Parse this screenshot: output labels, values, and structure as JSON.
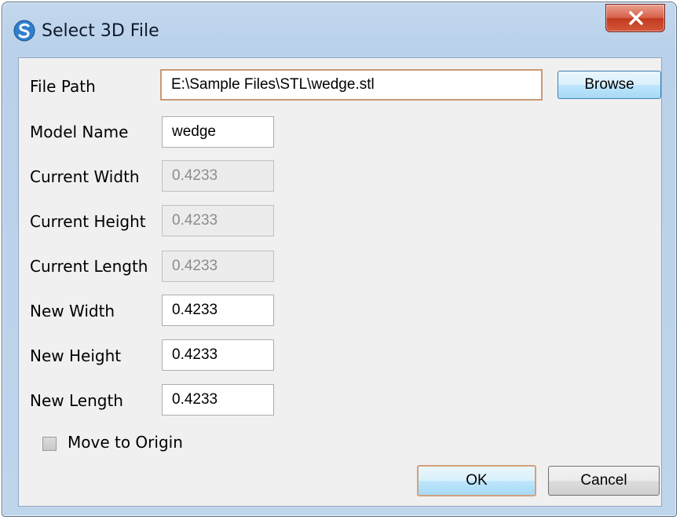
{
  "window": {
    "title": "Select 3D File"
  },
  "form": {
    "file_path": {
      "label": "File Path",
      "value": "E:\\Sample Files\\STL\\wedge.stl"
    },
    "browse_label": "Browse",
    "model_name": {
      "label": "Model Name",
      "value": "wedge"
    },
    "current_width": {
      "label": "Current Width",
      "value": "0.4233"
    },
    "current_height": {
      "label": "Current Height",
      "value": "0.4233"
    },
    "current_length": {
      "label": "Current Length",
      "value": "0.4233"
    },
    "new_width": {
      "label": "New Width",
      "value": "0.4233"
    },
    "new_height": {
      "label": "New Height",
      "value": "0.4233"
    },
    "new_length": {
      "label": "New Length",
      "value": "0.4233"
    },
    "move_to_origin": {
      "label": "Move to Origin",
      "checked": false,
      "enabled": false
    }
  },
  "buttons": {
    "ok": "OK",
    "cancel": "Cancel"
  },
  "icons": {
    "app": "app-logo-icon",
    "close": "close-icon"
  },
  "colors": {
    "title_bar": "#b9d1ea",
    "client_background": "#f0f0f0",
    "close_button": "#c7432a",
    "focus_border": "#c99a76"
  }
}
